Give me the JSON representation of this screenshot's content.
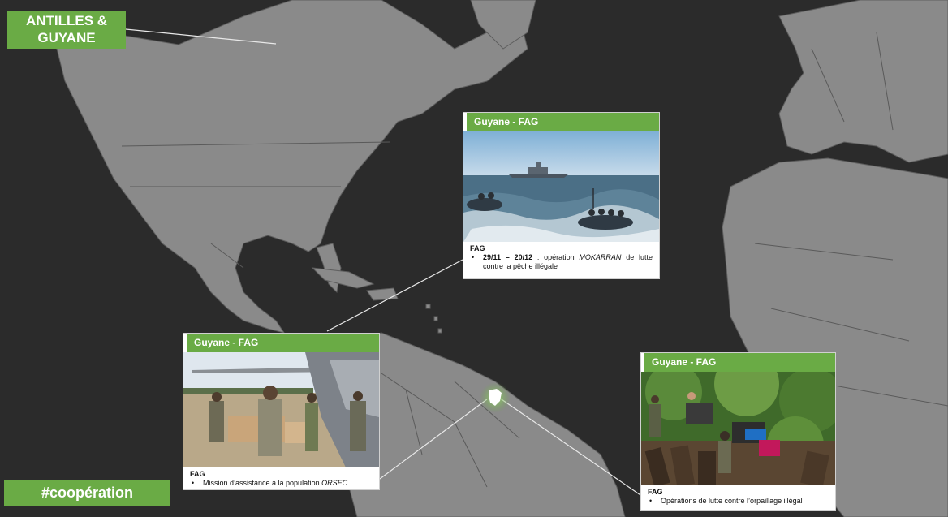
{
  "region_tag": {
    "line1": "ANTILLES &",
    "line2": "GUYANE"
  },
  "hashtag": "#coopération",
  "colors": {
    "ocean": "#2b2b2b",
    "land": "#8a8a8a",
    "accent": "#6aab45",
    "highlight": "#ffffff"
  },
  "map": {
    "highlighted_territory": "Guyane"
  },
  "cards": {
    "top": {
      "header": "Guyane - FAG",
      "unit": "FAG",
      "date": "29/11 – 20/12",
      "text_before": " : opération ",
      "operation": "MOKARRAN",
      "text_after": " de lutte contre la pêche illégale"
    },
    "left": {
      "header": "Guyane - FAG",
      "unit": "FAG",
      "text": "Mission d’assistance à la population ",
      "emphasis": "ORSEC"
    },
    "right": {
      "header": "Guyane - FAG",
      "unit": "FAG",
      "text": "Opérations de lutte contre l’orpaillage illégal"
    }
  }
}
